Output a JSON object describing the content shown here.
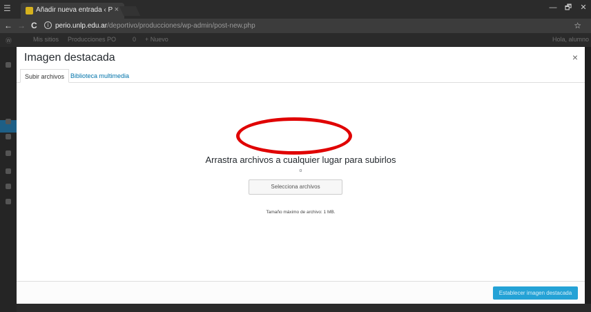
{
  "browser": {
    "tab_title": "Añadir nueva entrada ‹ P",
    "tab_close": "×",
    "window_controls": [
      "—",
      "🗗",
      "✕"
    ],
    "back": "←",
    "forward": "→",
    "reload": "C",
    "url_host": "perio.unlp.edu.ar",
    "url_path": "/deportivo/producciones/wp-admin/post-new.php",
    "bookmark": "☆"
  },
  "admin_bar": {
    "my_sites": "Mis sitios",
    "site_name": "Producciones PO",
    "comments": "0",
    "new": "+ Nuevo",
    "greeting": "Hola, alumno"
  },
  "modal": {
    "title": "Imagen destacada",
    "close": "×",
    "tabs": [
      "Subir archivos",
      "Biblioteca multimedia"
    ],
    "drop_text": "Arrastra archivos a cualquier lugar para subirlos",
    "or_text": "o",
    "select_button": "Selecciona archivos",
    "max_size": "Tamaño máximo de archivo: 1 MB.",
    "set_button": "Establecer imagen destacada"
  },
  "colors": {
    "highlight": "#e00000",
    "primary_button": "#24a2d6",
    "link": "#0073aa"
  }
}
